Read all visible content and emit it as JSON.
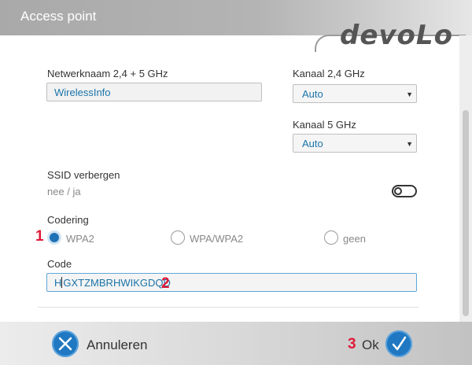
{
  "window": {
    "title": "Access point"
  },
  "brand": {
    "logo_text": "devoLo"
  },
  "network_name": {
    "label": "Netwerknaam 2,4 + 5 GHz",
    "value": "WirelessInfo"
  },
  "channel_24": {
    "label": "Kanaal 2,4 GHz",
    "selected": "Auto"
  },
  "channel_5": {
    "label": "Kanaal 5 GHz",
    "selected": "Auto"
  },
  "ssid_hide": {
    "label": "SSID verbergen",
    "toggle_text": "nee / ja",
    "enabled": false
  },
  "encryption": {
    "label": "Codering",
    "options": [
      {
        "label": "WPA2",
        "selected": true
      },
      {
        "label": "WPA/WPA2",
        "selected": false
      },
      {
        "label": "geen",
        "selected": false
      }
    ]
  },
  "code": {
    "label": "Code",
    "value": "GXTZMBRHWIKGDQD",
    "value_prefix": "H"
  },
  "markers": {
    "m1": "1",
    "m2": "2",
    "m3": "3"
  },
  "footer": {
    "cancel_label": "Annuleren",
    "ok_label": "Ok"
  },
  "colors": {
    "accent": "#1f78c1",
    "marker": "#e0193a",
    "value_text": "#1a73a8"
  }
}
